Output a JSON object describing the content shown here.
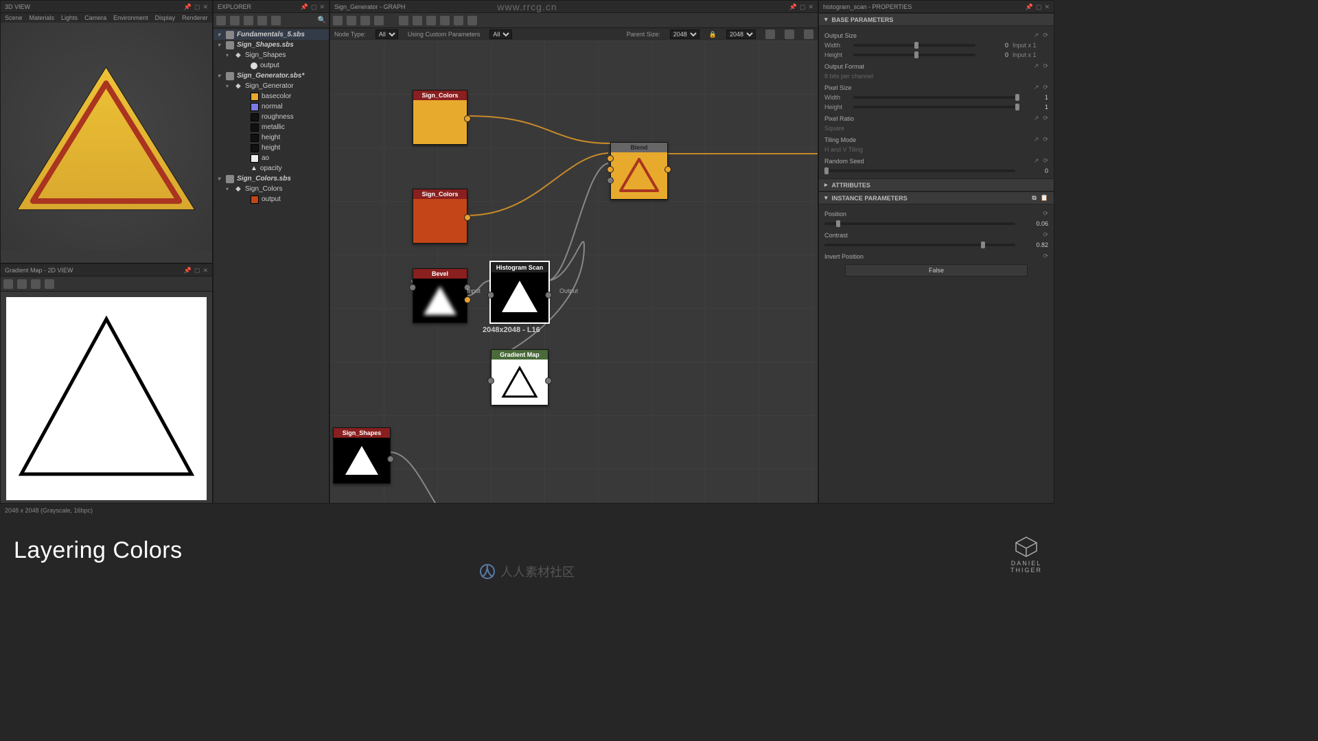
{
  "watermark": {
    "url": "www.rrcg.cn",
    "cn_text": "人人素材社区"
  },
  "caption": "Layering Colors",
  "logo": {
    "line1": "DANIEL",
    "line2": "THIGER"
  },
  "view3d": {
    "title": "3D VIEW",
    "menus": [
      "Scene",
      "Materials",
      "Lights",
      "Camera",
      "Environment",
      "Display",
      "Renderer"
    ]
  },
  "view2d": {
    "title": "Gradient Map - 2D VIEW",
    "status": "2048 x 2048 (Grayscale, 16bpc)"
  },
  "explorer": {
    "title": "EXPLORER",
    "items": [
      {
        "depth": 0,
        "arrow": "▾",
        "icon": "pkg",
        "label": "Fundamentals_5.sbs",
        "sel": true,
        "bold": true
      },
      {
        "depth": 0,
        "arrow": "▾",
        "icon": "pkg",
        "label": "Sign_Shapes.sbs",
        "bold": true
      },
      {
        "depth": 1,
        "arrow": "▾",
        "icon": "shape",
        "label": "Sign_Shapes"
      },
      {
        "depth": 3,
        "arrow": "",
        "icon": "circle-w",
        "label": "output"
      },
      {
        "depth": 0,
        "arrow": "▾",
        "icon": "pkg",
        "label": "Sign_Generator.sbs*",
        "bold": true,
        "ital": true,
        "sel2": true
      },
      {
        "depth": 1,
        "arrow": "▾",
        "icon": "shape",
        "label": "Sign_Generator"
      },
      {
        "depth": 3,
        "arrow": "",
        "icon": "sw-y",
        "label": "basecolor"
      },
      {
        "depth": 3,
        "arrow": "",
        "icon": "sw-b",
        "label": "normal"
      },
      {
        "depth": 3,
        "arrow": "",
        "icon": "sw-k",
        "label": "roughness"
      },
      {
        "depth": 3,
        "arrow": "",
        "icon": "sw-k",
        "label": "metallic"
      },
      {
        "depth": 3,
        "arrow": "",
        "icon": "sw-k",
        "label": "height"
      },
      {
        "depth": 3,
        "arrow": "",
        "icon": "sw-k",
        "label": "height"
      },
      {
        "depth": 3,
        "arrow": "",
        "icon": "sw-w",
        "label": "ao"
      },
      {
        "depth": 3,
        "arrow": "",
        "icon": "tri-w",
        "label": "opacity"
      },
      {
        "depth": 0,
        "arrow": "▾",
        "icon": "pkg",
        "label": "Sign_Colors.sbs",
        "bold": true
      },
      {
        "depth": 1,
        "arrow": "▾",
        "icon": "shape",
        "label": "Sign_Colors"
      },
      {
        "depth": 3,
        "arrow": "",
        "icon": "sw-r",
        "label": "output"
      }
    ]
  },
  "graph": {
    "title": "Sign_Generator - GRAPH",
    "nodeTypeLabel": "Node Type:",
    "nodeTypeValue": "All",
    "customParamLabel": "Using Custom Parameters",
    "customParamValue": "All",
    "parentSizeLabel": "Parent Size:",
    "parentSizeW": "2048",
    "parentSizeH": "2048",
    "nodes": {
      "sc1": {
        "title": "Sign_Colors",
        "titleColor": "#8a1f1f"
      },
      "sc2": {
        "title": "Sign_Colors",
        "titleColor": "#8a1f1f"
      },
      "bevel": {
        "title": "Bevel",
        "titleColor": "#8a1f1f"
      },
      "hist": {
        "title": "Histogram Scan",
        "titleColor": "#222",
        "input": "Input",
        "output": "Output",
        "info": "2048x2048 - L16"
      },
      "gmap": {
        "title": "Gradient Map",
        "titleColor": "#4a6a3a"
      },
      "shapes": {
        "title": "Sign_Shapes",
        "titleColor": "#8a1f1f"
      },
      "blend": {
        "title": "Blend",
        "titleColor": "#555"
      }
    }
  },
  "props": {
    "title": "histogram_scan - PROPERTIES",
    "sections": {
      "base": "BASE PARAMETERS",
      "attrs": "ATTRIBUTES",
      "inst": "INSTANCE PARAMETERS"
    },
    "outputSize": {
      "label": "Output Size",
      "width": "Width",
      "height": "Height",
      "zero": "0",
      "suffix": "Input x 1"
    },
    "outputFormat": {
      "label": "Output Format",
      "hint": "8 bits per channel"
    },
    "pixelSize": {
      "label": "Pixel Size",
      "width": "Width",
      "height": "Height",
      "one": "1"
    },
    "pixelRatio": {
      "label": "Pixel Ratio",
      "value": "Square"
    },
    "tiling": {
      "label": "Tiling Mode",
      "value": "H and V Tiling"
    },
    "seed": {
      "label": "Random Seed",
      "value": "0"
    },
    "position": {
      "label": "Position",
      "value": "0.06"
    },
    "contrast": {
      "label": "Contrast",
      "value": "0.82"
    },
    "invert": {
      "label": "Invert Position",
      "value": "False"
    }
  }
}
